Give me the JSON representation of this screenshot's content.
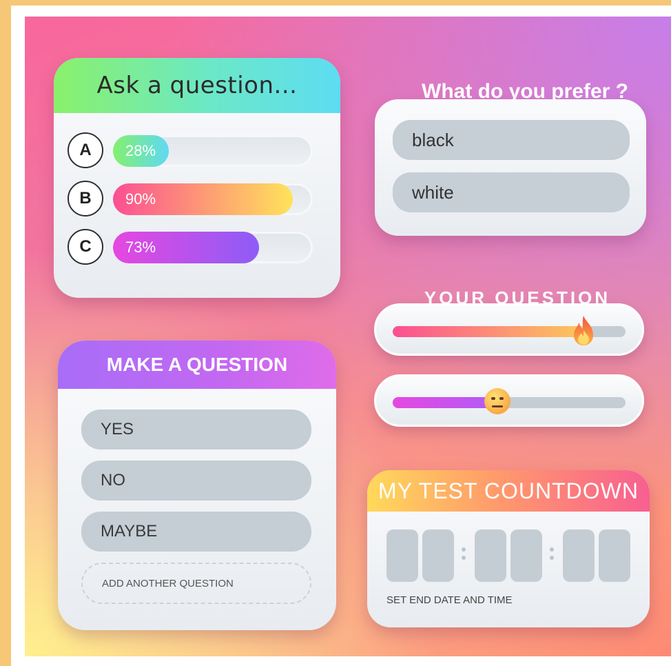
{
  "poll": {
    "title": "Ask a question...",
    "options": [
      {
        "letter": "A",
        "label": "28%",
        "percent": 28,
        "colors": [
          "#84f06e",
          "#5fd9f3"
        ]
      },
      {
        "letter": "B",
        "label": "90%",
        "percent": 90,
        "colors": [
          "#fb4f92",
          "#ffe35a"
        ]
      },
      {
        "letter": "C",
        "label": "73%",
        "percent": 73,
        "colors": [
          "#e548e0",
          "#8e5cf7"
        ]
      }
    ]
  },
  "prefer": {
    "title": "What do you prefer ?",
    "options": [
      "black",
      "white"
    ]
  },
  "slider_question": {
    "title": "YOUR QUESTION HERE",
    "sliders": [
      {
        "value": 0.82,
        "knob_icon": "fire-icon",
        "colors": [
          "#fb4f92",
          "#fcc85c"
        ]
      },
      {
        "value": 0.45,
        "knob_icon": "neutral-face-emoji-icon",
        "colors": [
          "#e548e0",
          "#b05cf5"
        ]
      }
    ]
  },
  "make_question": {
    "title": "MAKE A QUESTION",
    "options": [
      "YES",
      "NO",
      "MAYBE"
    ],
    "add_label": "ADD ANOTHER QUESTION"
  },
  "countdown": {
    "title": "MY TEST COUNTDOWN",
    "label": "SET END DATE AND TIME"
  }
}
